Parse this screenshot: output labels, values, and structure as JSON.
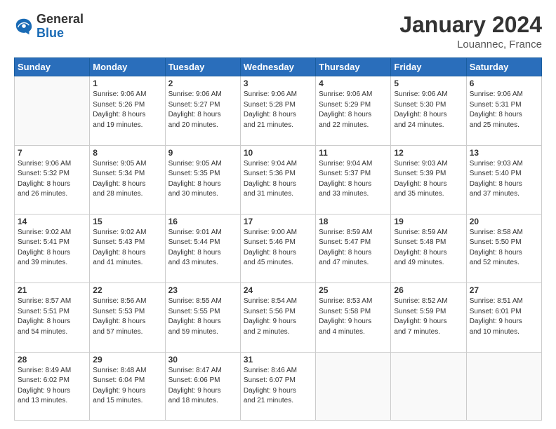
{
  "header": {
    "logo_general": "General",
    "logo_blue": "Blue",
    "month_title": "January 2024",
    "location": "Louannec, France"
  },
  "weekdays": [
    "Sunday",
    "Monday",
    "Tuesday",
    "Wednesday",
    "Thursday",
    "Friday",
    "Saturday"
  ],
  "weeks": [
    [
      {
        "num": "",
        "sunrise": "",
        "sunset": "",
        "daylight": ""
      },
      {
        "num": "1",
        "sunrise": "Sunrise: 9:06 AM",
        "sunset": "Sunset: 5:26 PM",
        "daylight": "Daylight: 8 hours and 19 minutes."
      },
      {
        "num": "2",
        "sunrise": "Sunrise: 9:06 AM",
        "sunset": "Sunset: 5:27 PM",
        "daylight": "Daylight: 8 hours and 20 minutes."
      },
      {
        "num": "3",
        "sunrise": "Sunrise: 9:06 AM",
        "sunset": "Sunset: 5:28 PM",
        "daylight": "Daylight: 8 hours and 21 minutes."
      },
      {
        "num": "4",
        "sunrise": "Sunrise: 9:06 AM",
        "sunset": "Sunset: 5:29 PM",
        "daylight": "Daylight: 8 hours and 22 minutes."
      },
      {
        "num": "5",
        "sunrise": "Sunrise: 9:06 AM",
        "sunset": "Sunset: 5:30 PM",
        "daylight": "Daylight: 8 hours and 24 minutes."
      },
      {
        "num": "6",
        "sunrise": "Sunrise: 9:06 AM",
        "sunset": "Sunset: 5:31 PM",
        "daylight": "Daylight: 8 hours and 25 minutes."
      }
    ],
    [
      {
        "num": "7",
        "sunrise": "Sunrise: 9:06 AM",
        "sunset": "Sunset: 5:32 PM",
        "daylight": "Daylight: 8 hours and 26 minutes."
      },
      {
        "num": "8",
        "sunrise": "Sunrise: 9:05 AM",
        "sunset": "Sunset: 5:34 PM",
        "daylight": "Daylight: 8 hours and 28 minutes."
      },
      {
        "num": "9",
        "sunrise": "Sunrise: 9:05 AM",
        "sunset": "Sunset: 5:35 PM",
        "daylight": "Daylight: 8 hours and 30 minutes."
      },
      {
        "num": "10",
        "sunrise": "Sunrise: 9:04 AM",
        "sunset": "Sunset: 5:36 PM",
        "daylight": "Daylight: 8 hours and 31 minutes."
      },
      {
        "num": "11",
        "sunrise": "Sunrise: 9:04 AM",
        "sunset": "Sunset: 5:37 PM",
        "daylight": "Daylight: 8 hours and 33 minutes."
      },
      {
        "num": "12",
        "sunrise": "Sunrise: 9:03 AM",
        "sunset": "Sunset: 5:39 PM",
        "daylight": "Daylight: 8 hours and 35 minutes."
      },
      {
        "num": "13",
        "sunrise": "Sunrise: 9:03 AM",
        "sunset": "Sunset: 5:40 PM",
        "daylight": "Daylight: 8 hours and 37 minutes."
      }
    ],
    [
      {
        "num": "14",
        "sunrise": "Sunrise: 9:02 AM",
        "sunset": "Sunset: 5:41 PM",
        "daylight": "Daylight: 8 hours and 39 minutes."
      },
      {
        "num": "15",
        "sunrise": "Sunrise: 9:02 AM",
        "sunset": "Sunset: 5:43 PM",
        "daylight": "Daylight: 8 hours and 41 minutes."
      },
      {
        "num": "16",
        "sunrise": "Sunrise: 9:01 AM",
        "sunset": "Sunset: 5:44 PM",
        "daylight": "Daylight: 8 hours and 43 minutes."
      },
      {
        "num": "17",
        "sunrise": "Sunrise: 9:00 AM",
        "sunset": "Sunset: 5:46 PM",
        "daylight": "Daylight: 8 hours and 45 minutes."
      },
      {
        "num": "18",
        "sunrise": "Sunrise: 8:59 AM",
        "sunset": "Sunset: 5:47 PM",
        "daylight": "Daylight: 8 hours and 47 minutes."
      },
      {
        "num": "19",
        "sunrise": "Sunrise: 8:59 AM",
        "sunset": "Sunset: 5:48 PM",
        "daylight": "Daylight: 8 hours and 49 minutes."
      },
      {
        "num": "20",
        "sunrise": "Sunrise: 8:58 AM",
        "sunset": "Sunset: 5:50 PM",
        "daylight": "Daylight: 8 hours and 52 minutes."
      }
    ],
    [
      {
        "num": "21",
        "sunrise": "Sunrise: 8:57 AM",
        "sunset": "Sunset: 5:51 PM",
        "daylight": "Daylight: 8 hours and 54 minutes."
      },
      {
        "num": "22",
        "sunrise": "Sunrise: 8:56 AM",
        "sunset": "Sunset: 5:53 PM",
        "daylight": "Daylight: 8 hours and 57 minutes."
      },
      {
        "num": "23",
        "sunrise": "Sunrise: 8:55 AM",
        "sunset": "Sunset: 5:55 PM",
        "daylight": "Daylight: 8 hours and 59 minutes."
      },
      {
        "num": "24",
        "sunrise": "Sunrise: 8:54 AM",
        "sunset": "Sunset: 5:56 PM",
        "daylight": "Daylight: 9 hours and 2 minutes."
      },
      {
        "num": "25",
        "sunrise": "Sunrise: 8:53 AM",
        "sunset": "Sunset: 5:58 PM",
        "daylight": "Daylight: 9 hours and 4 minutes."
      },
      {
        "num": "26",
        "sunrise": "Sunrise: 8:52 AM",
        "sunset": "Sunset: 5:59 PM",
        "daylight": "Daylight: 9 hours and 7 minutes."
      },
      {
        "num": "27",
        "sunrise": "Sunrise: 8:51 AM",
        "sunset": "Sunset: 6:01 PM",
        "daylight": "Daylight: 9 hours and 10 minutes."
      }
    ],
    [
      {
        "num": "28",
        "sunrise": "Sunrise: 8:49 AM",
        "sunset": "Sunset: 6:02 PM",
        "daylight": "Daylight: 9 hours and 13 minutes."
      },
      {
        "num": "29",
        "sunrise": "Sunrise: 8:48 AM",
        "sunset": "Sunset: 6:04 PM",
        "daylight": "Daylight: 9 hours and 15 minutes."
      },
      {
        "num": "30",
        "sunrise": "Sunrise: 8:47 AM",
        "sunset": "Sunset: 6:06 PM",
        "daylight": "Daylight: 9 hours and 18 minutes."
      },
      {
        "num": "31",
        "sunrise": "Sunrise: 8:46 AM",
        "sunset": "Sunset: 6:07 PM",
        "daylight": "Daylight: 9 hours and 21 minutes."
      },
      {
        "num": "",
        "sunrise": "",
        "sunset": "",
        "daylight": ""
      },
      {
        "num": "",
        "sunrise": "",
        "sunset": "",
        "daylight": ""
      },
      {
        "num": "",
        "sunrise": "",
        "sunset": "",
        "daylight": ""
      }
    ]
  ]
}
